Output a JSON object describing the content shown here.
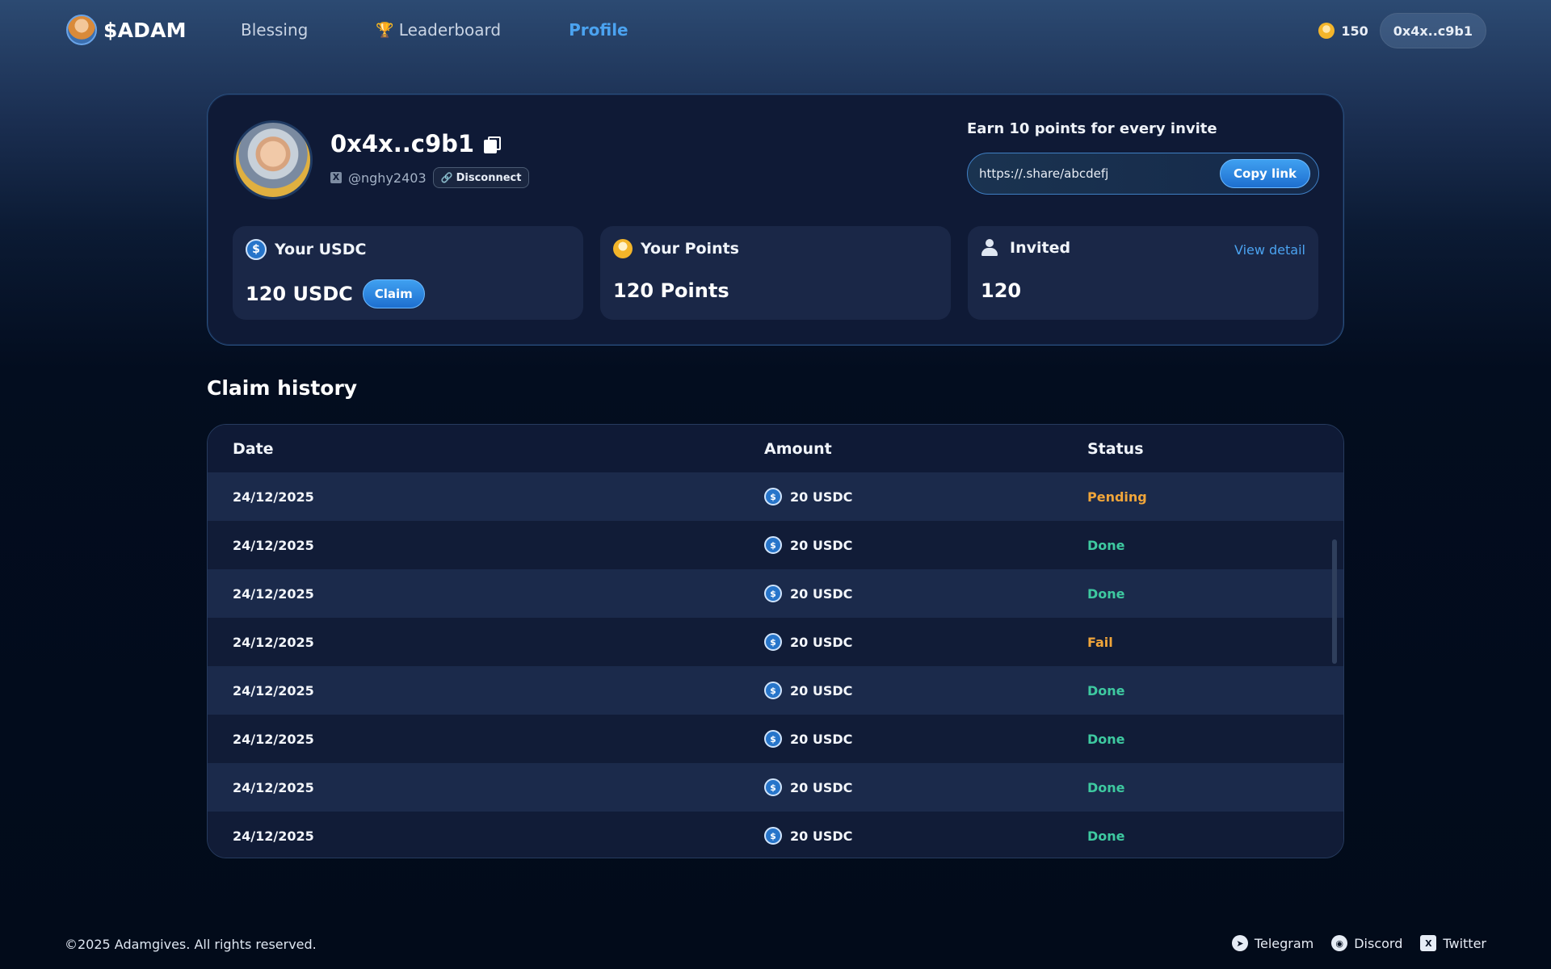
{
  "brand": {
    "name": "$ADAM",
    "logo_icon": "adam-avatar-icon"
  },
  "nav": [
    {
      "label": "Blessing",
      "active": false
    },
    {
      "label": "Leaderboard",
      "icon": "trophy-icon",
      "active": false
    },
    {
      "label": "Profile",
      "active": true
    }
  ],
  "header": {
    "points": "150",
    "wallet": "0x4x..c9b1"
  },
  "profile": {
    "address": "0x4x..c9b1",
    "handle": "@nghy2403",
    "disconnect_label": "Disconnect",
    "invite_label": "Earn 10 points for every invite",
    "invite_link": "https://.share/abcdefj",
    "copy_link_label": "Copy link"
  },
  "stats": {
    "usdc": {
      "label": "Your USDC",
      "value": "120 USDC",
      "claim_label": "Claim"
    },
    "points": {
      "label": "Your Points",
      "value": "120 Points"
    },
    "invited": {
      "label": "Invited",
      "value": "120",
      "view_detail_label": "View detail"
    }
  },
  "history": {
    "title": "Claim history",
    "columns": [
      "Date",
      "Amount",
      "Status"
    ],
    "rows": [
      {
        "date": "24/12/2025",
        "amount": "20 USDC",
        "status": "Pending"
      },
      {
        "date": "24/12/2025",
        "amount": "20 USDC",
        "status": "Done"
      },
      {
        "date": "24/12/2025",
        "amount": "20 USDC",
        "status": "Done"
      },
      {
        "date": "24/12/2025",
        "amount": "20 USDC",
        "status": "Fail"
      },
      {
        "date": "24/12/2025",
        "amount": "20 USDC",
        "status": "Done"
      },
      {
        "date": "24/12/2025",
        "amount": "20 USDC",
        "status": "Done"
      },
      {
        "date": "24/12/2025",
        "amount": "20 USDC",
        "status": "Done"
      },
      {
        "date": "24/12/2025",
        "amount": "20 USDC",
        "status": "Done"
      }
    ],
    "status_colors": {
      "Pending": "#f0a53a",
      "Done": "#3ec9a0",
      "Fail": "#f0a53a"
    }
  },
  "footer": {
    "copyright": "©2025 Adamgives. All rights reserved.",
    "links": [
      {
        "label": "Telegram",
        "icon": "telegram-icon"
      },
      {
        "label": "Discord",
        "icon": "discord-icon"
      },
      {
        "label": "Twitter",
        "icon": "x-icon"
      }
    ]
  },
  "colors": {
    "accent": "#4ba3f0",
    "card": "#0f1a36"
  }
}
